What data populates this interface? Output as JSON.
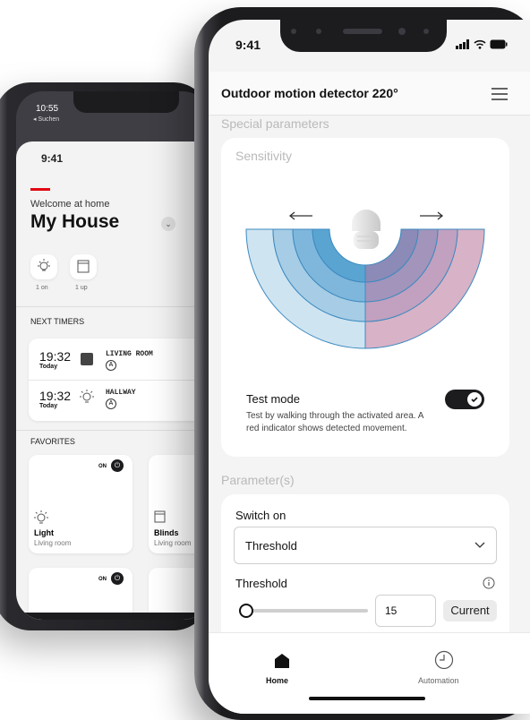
{
  "back_app": {
    "status_time": "10:55",
    "back_label": "◂ Suchen",
    "header_time": "9:41",
    "welcome": "Welcome at home",
    "house_name": "My House",
    "quick": [
      {
        "icon": "bulb-icon",
        "label": "1 on"
      },
      {
        "icon": "blind-icon",
        "label": "1 up"
      }
    ],
    "next_timers_title": "NEXT TIMERS",
    "timers": [
      {
        "time": "19:32",
        "day": "Today",
        "icon": "blind-icon",
        "room": "LIVING ROOM",
        "mode": "A"
      },
      {
        "time": "19:32",
        "day": "Today",
        "icon": "bulb-icon",
        "room": "HALLWAY",
        "mode": "A"
      }
    ],
    "favorites_title": "FAVORITES",
    "favorites": [
      {
        "state": "ON",
        "name": "Light",
        "room": "Living room"
      },
      {
        "state": "",
        "name": "Blinds",
        "room": "Living room"
      }
    ],
    "favorites_row2_state": "ON"
  },
  "front_app": {
    "status_time": "9:41",
    "title": "Outdoor motion detector 220°",
    "special_parameters": "Special parameters",
    "sensitivity": "Sensitivity",
    "test_mode": {
      "label": "Test mode",
      "description": "Test by walking through the activated area. A red indicator shows detected movement.",
      "enabled": true
    },
    "parameters_title": "Parameter(s)",
    "switch_on": {
      "label": "Switch on",
      "selected": "Threshold"
    },
    "threshold": {
      "label": "Threshold",
      "value": "15",
      "current_button": "Current",
      "slider_level": 0
    },
    "tabbar": [
      {
        "icon": "home-icon",
        "label": "Home",
        "active": true
      },
      {
        "icon": "clock-icon",
        "label": "Automation",
        "active": false
      }
    ]
  },
  "colors": {
    "accent_red": "#e30613",
    "detector_blue": [
      "#cfe4f1",
      "#a6cde5",
      "#7fb7dc",
      "#5aa4d2"
    ],
    "detector_red": [
      "#d8b2c6",
      "#c2a0bf",
      "#a394bb",
      "#8c8ab6"
    ]
  }
}
